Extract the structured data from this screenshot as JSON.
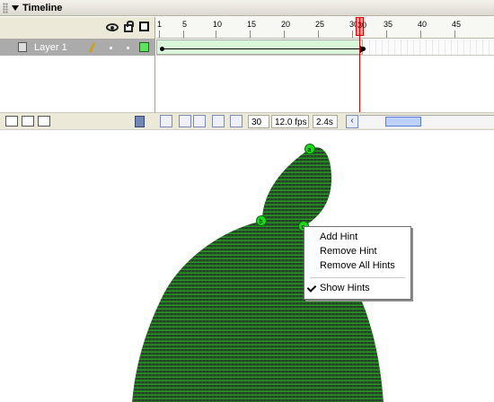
{
  "timeline": {
    "title": "Timeline",
    "layer_name": "Layer 1",
    "ruler_labels": [
      "1",
      "5",
      "10",
      "15",
      "20",
      "25",
      "30",
      "35",
      "40",
      "45"
    ],
    "current_frame": "30",
    "frame_rate": "12.0 fps",
    "elapsed": "2.4s"
  },
  "context_menu": {
    "items": [
      "Add Hint",
      "Remove Hint",
      "Remove All Hints",
      "Show Hints"
    ],
    "checked": "Show Hints"
  },
  "stage": {
    "hint_labels": [
      "a",
      "b",
      "c"
    ],
    "fill_top": "#2c2c2c",
    "fill_bottom": "#1ea11e"
  }
}
